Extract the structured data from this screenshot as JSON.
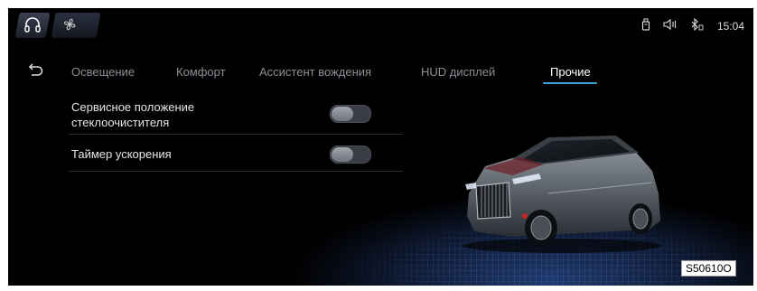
{
  "topbar": {
    "home_icon": "headset-home-icon",
    "fan_icon": "fan-icon",
    "status": {
      "icons": [
        "usb-icon",
        "volume-icon",
        "bluetooth-icon"
      ],
      "time": "15:04"
    }
  },
  "tabs": [
    {
      "label": "Освещение",
      "active": false
    },
    {
      "label": "Комфорт",
      "active": false
    },
    {
      "label": "Ассистент вождения",
      "active": false
    },
    {
      "label": "HUD дисплей",
      "active": false
    },
    {
      "label": "Прочие",
      "active": true
    }
  ],
  "settings": [
    {
      "label_line1": "Сервисное положение",
      "label_line2": "стеклоочистителя",
      "enabled": false
    },
    {
      "label_line1": "Таймер ускорения",
      "enabled": false
    }
  ],
  "colors": {
    "accent": "#3fa3d9",
    "background": "#000000"
  },
  "figure_code": "S50610O"
}
